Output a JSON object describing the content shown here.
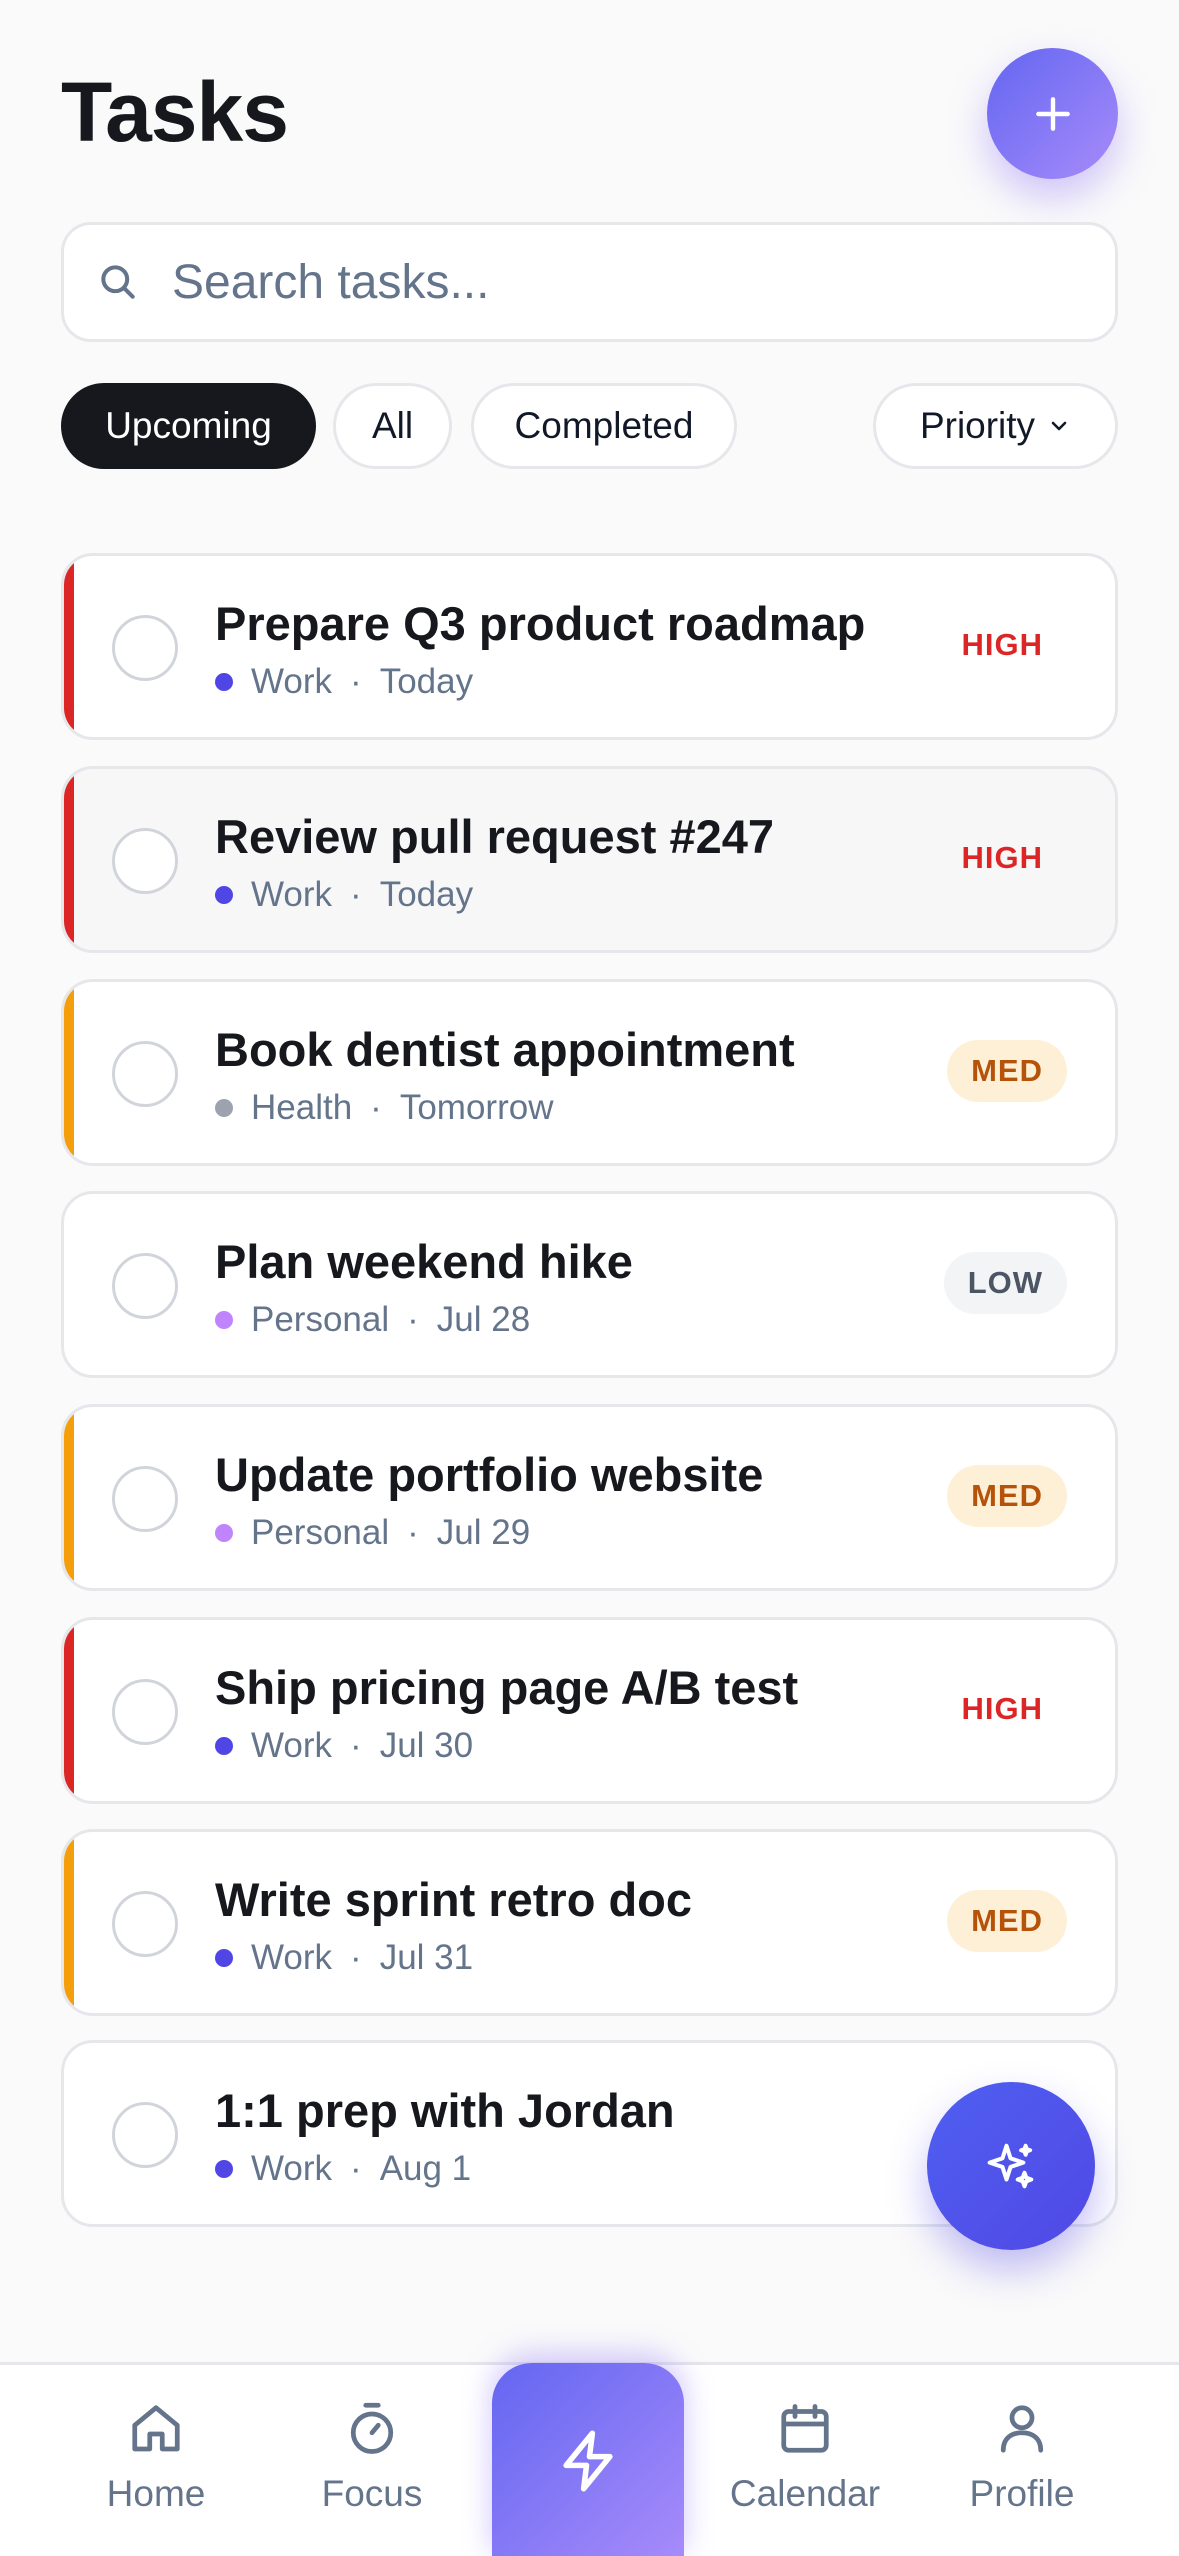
{
  "header": {
    "title": "Tasks"
  },
  "search": {
    "placeholder": "Search tasks..."
  },
  "filters": {
    "chips": [
      {
        "label": "Upcoming",
        "active": true
      },
      {
        "label": "All",
        "active": false
      },
      {
        "label": "Completed",
        "active": false
      }
    ],
    "sort_label": "Priority"
  },
  "tasks": [
    {
      "title": "Prepare Q3 product roadmap",
      "category": "Work",
      "category_color": "#4f46e5",
      "due": "Today",
      "priority": "HIGH",
      "priority_color": "#dc2626"
    },
    {
      "title": "Review pull request #247",
      "category": "Work",
      "category_color": "#4f46e5",
      "due": "Today",
      "priority": "HIGH",
      "priority_color": "#dc2626"
    },
    {
      "title": "Book dentist appointment",
      "category": "Health",
      "category_color": "#9ca3af",
      "due": "Tomorrow",
      "priority": "MED",
      "priority_color": "#f59e0b"
    },
    {
      "title": "Plan weekend hike",
      "category": "Personal",
      "category_color": "#c084fc",
      "due": "Jul 28",
      "priority": "LOW",
      "priority_color": "#9ca3af"
    },
    {
      "title": "Update portfolio website",
      "category": "Personal",
      "category_color": "#c084fc",
      "due": "Jul 29",
      "priority": "MED",
      "priority_color": "#f59e0b"
    },
    {
      "title": "Ship pricing page A/B test",
      "category": "Work",
      "category_color": "#4f46e5",
      "due": "Jul 30",
      "priority": "HIGH",
      "priority_color": "#dc2626"
    },
    {
      "title": "Write sprint retro doc",
      "category": "Work",
      "category_color": "#4f46e5",
      "due": "Jul 31",
      "priority": "MED",
      "priority_color": "#f59e0b"
    },
    {
      "title": "1:1 prep with Jordan",
      "category": "Work",
      "category_color": "#4f46e5",
      "due": "Aug 1",
      "priority": "",
      "priority_color": ""
    }
  ],
  "meta_separator": "·",
  "nav": {
    "home": "Home",
    "focus": "Focus",
    "calendar": "Calendar",
    "profile": "Profile"
  },
  "icons": {
    "add": "plus-icon",
    "search": "search-icon",
    "sort": "chevron-down-icon",
    "fab": "sparkles-icon",
    "nav_home": "home-icon",
    "nav_focus": "stopwatch-icon",
    "nav_center": "lightning-icon",
    "nav_calendar": "calendar-icon",
    "nav_profile": "user-icon"
  },
  "colors": {
    "accent": "#4f46e5",
    "gradient_start": "#6366f1",
    "gradient_end": "#a78bfa",
    "high": "#dc2626",
    "med": "#f59e0b",
    "low": "#9ca3af"
  }
}
